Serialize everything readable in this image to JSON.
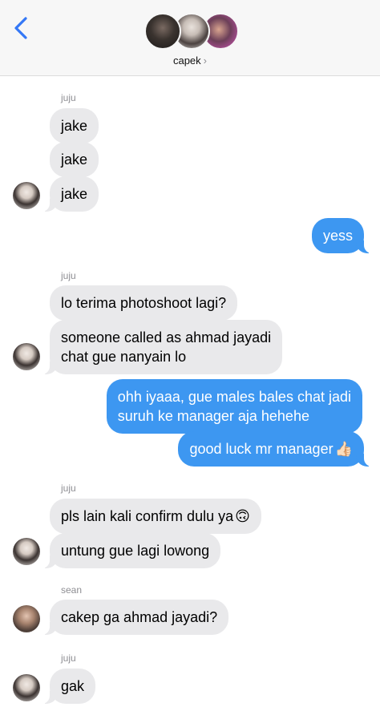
{
  "header": {
    "group_name": "capek",
    "chevron": "›",
    "icons": [
      "back-chevron-icon",
      "group-avatar-stack"
    ]
  },
  "colors": {
    "incoming_bubble": "#e9e9eb",
    "outgoing_bubble": "#3d97f1",
    "accent": "#3478f6"
  },
  "messages": {
    "s1": "juju",
    "m1": "jake",
    "m2": "jake",
    "m3": "jake",
    "m4": "yess",
    "s2": "juju",
    "m5": "lo terima photoshoot lagi?",
    "m6a": "someone called as ahmad jayadi",
    "m6b": "chat gue nanyain lo",
    "m7a": "ohh iyaaa, gue males bales chat jadi",
    "m7b": "suruh ke manager aja hehehe",
    "m8": "good luck mr manager",
    "m8_emoji": "👍🏻",
    "s3": "juju",
    "m9": "pls lain kali confirm dulu ya",
    "m9_emoji": "🙃",
    "m10": "untung gue lagi lowong",
    "s4": "sean",
    "m11": "cakep ga ahmad jayadi?",
    "s5": "juju",
    "m12": "gak"
  }
}
